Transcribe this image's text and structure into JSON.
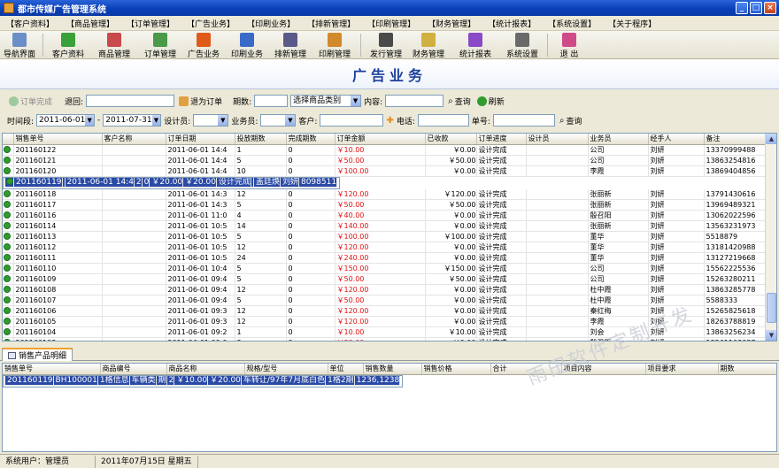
{
  "window": {
    "title": "都市传媒广告管理系统"
  },
  "menu": [
    "【客户资料】",
    "【商品管理】",
    "【订单管理】",
    "【广告业务】",
    "【印刷业务】",
    "【排新管理】",
    "【印刷管理】",
    "【财务管理】",
    "【统计报表】",
    "【系统设置】",
    "【关于程序】"
  ],
  "toolbar": [
    {
      "label": "导航界面",
      "icon": "navigation-icon",
      "color": "#6a8fc8"
    },
    {
      "label": "客户资料",
      "icon": "customers-icon",
      "color": "#3aa03a"
    },
    {
      "label": "商品管理",
      "icon": "products-icon",
      "color": "#c84a4a"
    },
    {
      "label": "订单管理",
      "icon": "orders-icon",
      "color": "#4a9a4a"
    },
    {
      "label": "广告业务",
      "icon": "ad-business-icon",
      "color": "#e05a1a"
    },
    {
      "label": "印刷业务",
      "icon": "print-business-icon",
      "color": "#3a6ac8"
    },
    {
      "label": "排新管理",
      "icon": "typeset-icon",
      "color": "#5a5a8a"
    },
    {
      "label": "印刷管理",
      "icon": "print-manage-icon",
      "color": "#d08a2a"
    },
    {
      "label": "发行管理",
      "icon": "distribution-icon",
      "color": "#4a4a4a"
    },
    {
      "label": "财务管理",
      "icon": "finance-icon",
      "color": "#d0b040"
    },
    {
      "label": "统计报表",
      "icon": "report-icon",
      "color": "#8a4ac8"
    },
    {
      "label": "系统设置",
      "icon": "settings-icon",
      "color": "#6a6a6a"
    },
    {
      "label": "退 出",
      "icon": "exit-icon",
      "color": "#d04a8a"
    }
  ],
  "banner": "广告业务",
  "filter1": {
    "order_done": "订单完成",
    "back_label": "退回:",
    "cancel_order": "退为订单",
    "period_label": "期数:",
    "category_select": "选择商品类别",
    "content_label": "内容:",
    "query": "查询",
    "refresh": "刷新"
  },
  "filter2": {
    "time_label": "时间段:",
    "date_from": "2011-06-01",
    "dash": "-",
    "date_to": "2011-07-31",
    "designer_label": "设计员:",
    "salesman_label": "业务员:",
    "customer_label": "客户:",
    "phone_label": "电话:",
    "order_no_label": "单号:",
    "query": "查询"
  },
  "grid": {
    "columns": [
      "销售单号",
      "客户名称",
      "订单日期",
      "投放期数",
      "完成期数",
      "订单金额",
      "已收款",
      "订单进度",
      "设计员",
      "业务员",
      "经手人",
      "备注"
    ],
    "rows": [
      [
        "201160122",
        "",
        "2011-06-01 14:4",
        "1",
        "0",
        "￥10.00",
        "￥0.00",
        "设计完成",
        "",
        "公司",
        "刘妍",
        "13370999488"
      ],
      [
        "201160121",
        "",
        "2011-06-01 14:4",
        "5",
        "0",
        "￥50.00",
        "￥50.00",
        "设计完成",
        "",
        "公司",
        "刘妍",
        "13863254816"
      ],
      [
        "201160120",
        "",
        "2011-06-01 14:4",
        "10",
        "0",
        "￥100.00",
        "￥0.00",
        "设计完成",
        "",
        "李霞",
        "刘妍",
        "13869404856"
      ],
      [
        "201160119",
        "",
        "2011-06-01 14:4",
        "2",
        "0",
        "￥20.00",
        "￥20.00",
        "设计完成",
        "",
        "盖廷焕",
        "刘妍",
        "8098511"
      ],
      [
        "201160118",
        "",
        "2011-06-01 14:3",
        "12",
        "0",
        "￥120.00",
        "￥120.00",
        "设计完成",
        "",
        "张丽新",
        "刘妍",
        "13791430616"
      ],
      [
        "201160117",
        "",
        "2011-06-01 14:3",
        "5",
        "0",
        "￥50.00",
        "￥50.00",
        "设计完成",
        "",
        "张丽新",
        "刘妍",
        "13969489321"
      ],
      [
        "201160116",
        "",
        "2011-06-01 11:0",
        "4",
        "0",
        "￥40.00",
        "￥0.00",
        "设计完成",
        "",
        "殷召阳",
        "刘妍",
        "13062022596"
      ],
      [
        "201160114",
        "",
        "2011-06-01 10:5",
        "14",
        "0",
        "￥140.00",
        "￥0.00",
        "设计完成",
        "",
        "张丽新",
        "刘妍",
        "13563231973"
      ],
      [
        "201160113",
        "",
        "2011-06-01 10:5",
        "5",
        "0",
        "￥100.00",
        "￥100.00",
        "设计完成",
        "",
        "董华",
        "刘妍",
        "5518879"
      ],
      [
        "201160112",
        "",
        "2011-06-01 10:5",
        "12",
        "0",
        "￥120.00",
        "￥0.00",
        "设计完成",
        "",
        "董华",
        "刘妍",
        "13181420988"
      ],
      [
        "201160111",
        "",
        "2011-06-01 10:5",
        "24",
        "0",
        "￥240.00",
        "￥0.00",
        "设计完成",
        "",
        "董华",
        "刘妍",
        "13127219668"
      ],
      [
        "201160110",
        "",
        "2011-06-01 10:4",
        "5",
        "0",
        "￥150.00",
        "￥150.00",
        "设计完成",
        "",
        "公司",
        "刘妍",
        "15562225536"
      ],
      [
        "201160109",
        "",
        "2011-06-01 09:4",
        "5",
        "0",
        "￥50.00",
        "￥50.00",
        "设计完成",
        "",
        "公司",
        "刘妍",
        "15263280211"
      ],
      [
        "201160108",
        "",
        "2011-06-01 09:4",
        "12",
        "0",
        "￥120.00",
        "￥0.00",
        "设计完成",
        "",
        "杜中霞",
        "刘妍",
        "13863285778"
      ],
      [
        "201160107",
        "",
        "2011-06-01 09:4",
        "5",
        "0",
        "￥50.00",
        "￥0.00",
        "设计完成",
        "",
        "杜中霞",
        "刘妍",
        "5588333"
      ],
      [
        "201160106",
        "",
        "2011-06-01 09:3",
        "12",
        "0",
        "￥120.00",
        "￥0.00",
        "设计完成",
        "",
        "秦红梅",
        "刘妍",
        "15265825618"
      ],
      [
        "201160105",
        "",
        "2011-06-01 09:3",
        "12",
        "0",
        "￥120.00",
        "￥0.00",
        "设计完成",
        "",
        "李霞",
        "刘妍",
        "18263788819"
      ],
      [
        "201160104",
        "",
        "2011-06-01 09:2",
        "1",
        "0",
        "￥10.00",
        "￥10.00",
        "设计完成",
        "",
        "刘会",
        "刘妍",
        "13863256234"
      ],
      [
        "201160103",
        "",
        "2011-06-01 09:0",
        "3",
        "0",
        "￥30.00",
        "￥0.00",
        "设计完成",
        "",
        "殷召阳",
        "刘妍",
        "13561108037"
      ]
    ],
    "selected_index": 3
  },
  "tab": {
    "label": "销售产品明细"
  },
  "detail": {
    "columns": [
      "销售单号",
      "商品编号",
      "商品名称",
      "规格/型号",
      "单位",
      "销售数量",
      "销售价格",
      "合计",
      "项目内容",
      "项目要求",
      "期数"
    ],
    "rows": [
      [
        "201160119",
        "BH100001",
        "1格信息",
        "车辆类",
        "期",
        "2",
        "￥10.00",
        "￥20.00",
        "车转让/97年7月底白色",
        "1格2期",
        "1236,1238"
      ]
    ]
  },
  "watermark": "雨田软件定制开发",
  "status": {
    "user": "系统用户：管理员",
    "date": "2011年07月15日 星期五"
  }
}
